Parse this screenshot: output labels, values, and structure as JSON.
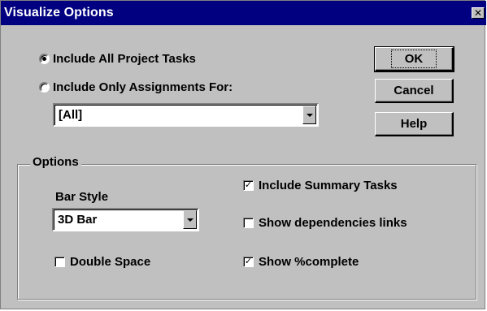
{
  "window": {
    "title": "Visualize Options",
    "close_glyph": "✕"
  },
  "scope": {
    "include_all_label": "Include All Project Tasks",
    "include_all_checked": true,
    "include_only_label": "Include Only Assignments For:",
    "include_only_checked": false,
    "assignee_value": "[All]"
  },
  "buttons": {
    "ok": "OK",
    "cancel": "Cancel",
    "help": "Help"
  },
  "options": {
    "legend": "Options",
    "bar_style_label": "Bar Style",
    "bar_style_value": "3D Bar",
    "double_space": {
      "label": "Double Space",
      "checked": false
    },
    "include_summary_tasks": {
      "label": "Include Summary Tasks",
      "checked": true
    },
    "show_dependencies_links": {
      "label": "Show dependencies links",
      "checked": false
    },
    "show_percent_complete": {
      "label": "Show %complete",
      "checked": true
    }
  },
  "icons": {
    "check_glyph": "✓"
  }
}
